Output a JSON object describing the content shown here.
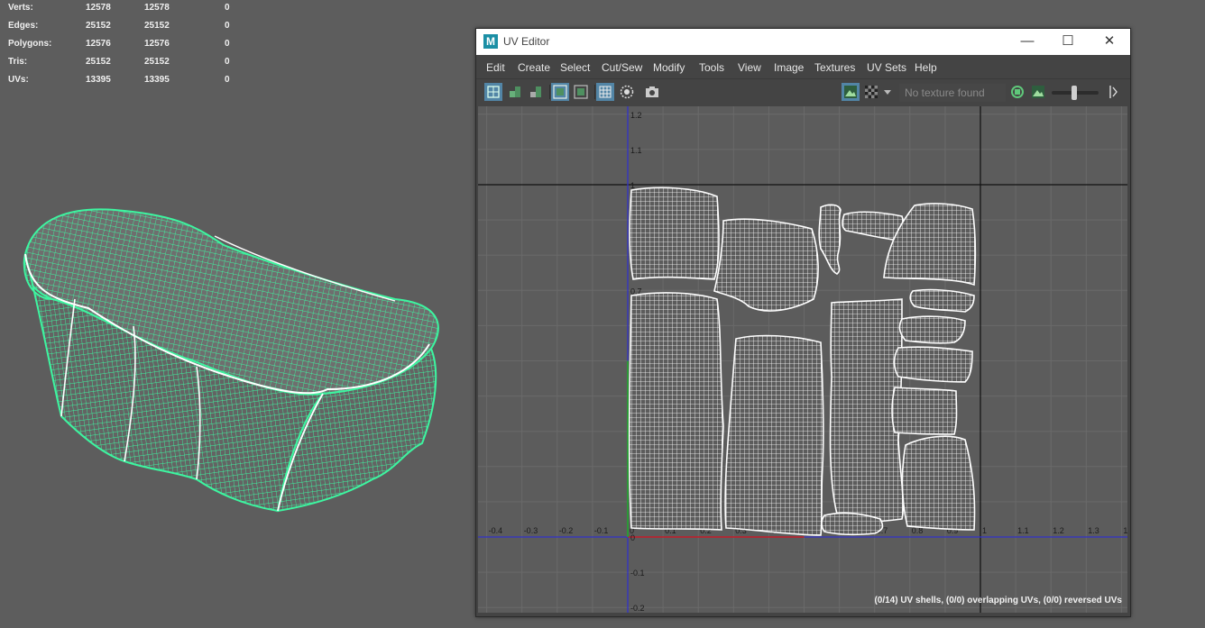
{
  "hud": {
    "rows": [
      {
        "label": "Verts:",
        "v1": "12578",
        "v2": "12578",
        "v3": "0"
      },
      {
        "label": "Edges:",
        "v1": "25152",
        "v2": "25152",
        "v3": "0"
      },
      {
        "label": "Polygons:",
        "v1": "12576",
        "v2": "12576",
        "v3": "0"
      },
      {
        "label": "Tris:",
        "v1": "25152",
        "v2": "25152",
        "v3": "0"
      },
      {
        "label": "UVs:",
        "v1": "13395",
        "v2": "13395",
        "v3": "0"
      }
    ]
  },
  "window": {
    "title": "UV Editor",
    "logo": "M",
    "controls": {
      "minimize": "—",
      "maximize": "☐",
      "close": "✕"
    }
  },
  "menu": {
    "items": [
      "Edit",
      "Create",
      "Select",
      "Cut/Sew",
      "Modify",
      "Tools",
      "View",
      "Image",
      "Textures",
      "UV Sets",
      "Help"
    ]
  },
  "toolbar": {
    "texture_placeholder": "No texture found",
    "icons": [
      "uv-shell-select-icon",
      "uv-vertex-icon",
      "uv-face-icon",
      "isolate-select-icon",
      "uv-edit-frame-icon",
      "grid-snap-icon",
      "soft-select-icon",
      "snapshot-camera-icon",
      "display-image-icon",
      "checker-icon",
      "dropdown-arrow-icon",
      "texture-refresh-icon",
      "image-display-icon",
      "exposure-slider",
      "gamma-toggle-icon"
    ]
  },
  "uv_grid": {
    "u_labels": [
      "-0.4",
      "-0.3",
      "-0.2",
      "-0.1",
      "0",
      "0.1",
      "0.2",
      "0.3",
      "0.4",
      "0.5",
      "0.6",
      "0.7",
      "0.8",
      "0.9",
      "1",
      "1.1",
      "1.2",
      "1.3",
      "1"
    ],
    "v_labels": [
      "1.2",
      "1.1",
      "1",
      "0.9",
      "0.8",
      "0.7",
      "0.6",
      "0.5",
      "0.4",
      "0.3",
      "0.2",
      "0.1",
      "0",
      "-0.1",
      "-0.2"
    ],
    "colors": {
      "grid": "#6a6a6a",
      "axis_u": "#3232c8",
      "axis_v": "#3232c8",
      "border": "#111111",
      "u_positive": "#c82020",
      "v_positive": "#20b020",
      "uv_wire": "#ffffff"
    }
  },
  "status": "(0/14) UV shells, (0/0) overlapping UVs, (0/0) reversed UVs",
  "mesh": {
    "wire_color": "#3df5a0",
    "seam_color": "#ffffff"
  }
}
